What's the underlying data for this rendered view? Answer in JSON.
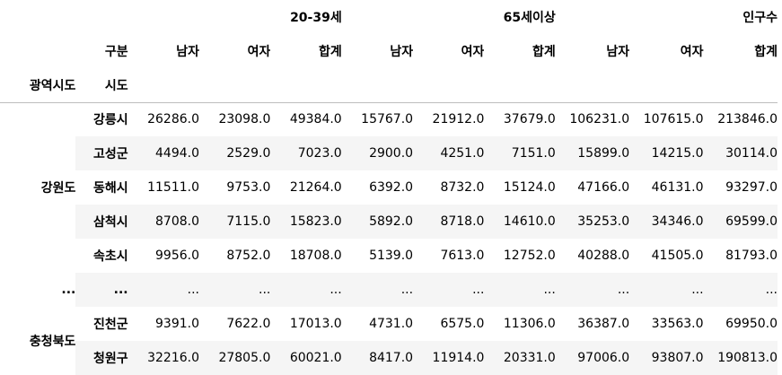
{
  "table": {
    "column_groups": [
      "20-39세",
      "65세이상",
      "인구수"
    ],
    "column_level_name": "구분",
    "sub_columns": [
      "남자",
      "여자",
      "합계",
      "남자",
      "여자",
      "합계",
      "남자",
      "여자",
      "합계"
    ],
    "index_names": [
      "광역시도",
      "시도"
    ],
    "rows": [
      {
        "region": "강원도",
        "city": "강릉시",
        "values": [
          "26286.0",
          "23098.0",
          "49384.0",
          "15767.0",
          "21912.0",
          "37679.0",
          "106231.0",
          "107615.0",
          "213846.0"
        ]
      },
      {
        "region": "",
        "city": "고성군",
        "values": [
          "4494.0",
          "2529.0",
          "7023.0",
          "2900.0",
          "4251.0",
          "7151.0",
          "15899.0",
          "14215.0",
          "30114.0"
        ]
      },
      {
        "region": "",
        "city": "동해시",
        "values": [
          "11511.0",
          "9753.0",
          "21264.0",
          "6392.0",
          "8732.0",
          "15124.0",
          "47166.0",
          "46131.0",
          "93297.0"
        ]
      },
      {
        "region": "",
        "city": "삼척시",
        "values": [
          "8708.0",
          "7115.0",
          "15823.0",
          "5892.0",
          "8718.0",
          "14610.0",
          "35253.0",
          "34346.0",
          "69599.0"
        ]
      },
      {
        "region": "",
        "city": "속초시",
        "values": [
          "9956.0",
          "8752.0",
          "18708.0",
          "5139.0",
          "7613.0",
          "12752.0",
          "40288.0",
          "41505.0",
          "81793.0"
        ]
      },
      {
        "region": "...",
        "city": "...",
        "values": [
          "...",
          "...",
          "...",
          "...",
          "...",
          "...",
          "...",
          "...",
          "..."
        ]
      },
      {
        "region": "충청북도",
        "city": "진천군",
        "values": [
          "9391.0",
          "7622.0",
          "17013.0",
          "4731.0",
          "6575.0",
          "11306.0",
          "36387.0",
          "33563.0",
          "69950.0"
        ]
      },
      {
        "region": "",
        "city": "청원구",
        "values": [
          "32216.0",
          "27805.0",
          "60021.0",
          "8417.0",
          "11914.0",
          "20331.0",
          "97006.0",
          "93807.0",
          "190813.0"
        ]
      }
    ]
  }
}
